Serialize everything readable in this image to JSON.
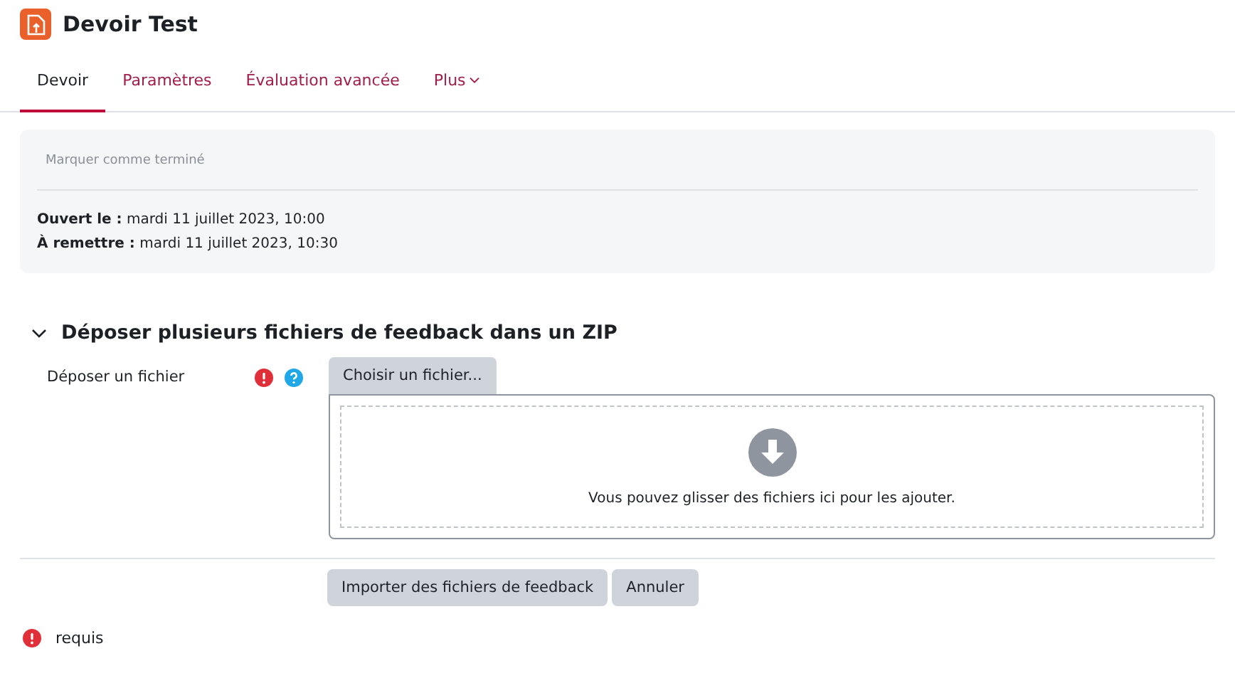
{
  "header": {
    "title": "Devoir Test"
  },
  "tabs": [
    {
      "label": "Devoir",
      "selected": true
    },
    {
      "label": "Paramètres",
      "selected": false
    },
    {
      "label": "Évaluation avancée",
      "selected": false
    },
    {
      "label": "Plus",
      "selected": false,
      "kind": "dropdown"
    }
  ],
  "completion": {
    "button": "Marquer comme terminé"
  },
  "dates": [
    "**Ouvert le :** mardi 11 juillet 2023, 10:00",
    "**À remettre :** mardi 11 juillet 2023, 10:30"
  ],
  "section": {
    "title": "Déposer plusieurs fichiers de feedback dans un ZIP",
    "expanded": true
  },
  "field": {
    "label": "Déposer un fichier",
    "required": true,
    "help": true,
    "choose_button": "Choisir un fichier...",
    "drop_hint": "Vous pouvez glisser des fichiers ici pour les ajouter."
  },
  "buttons": [
    {
      "label": "Importer des fichiers de feedback"
    },
    {
      "label": "Annuler"
    }
  ],
  "legend": {
    "text": "requis"
  }
}
